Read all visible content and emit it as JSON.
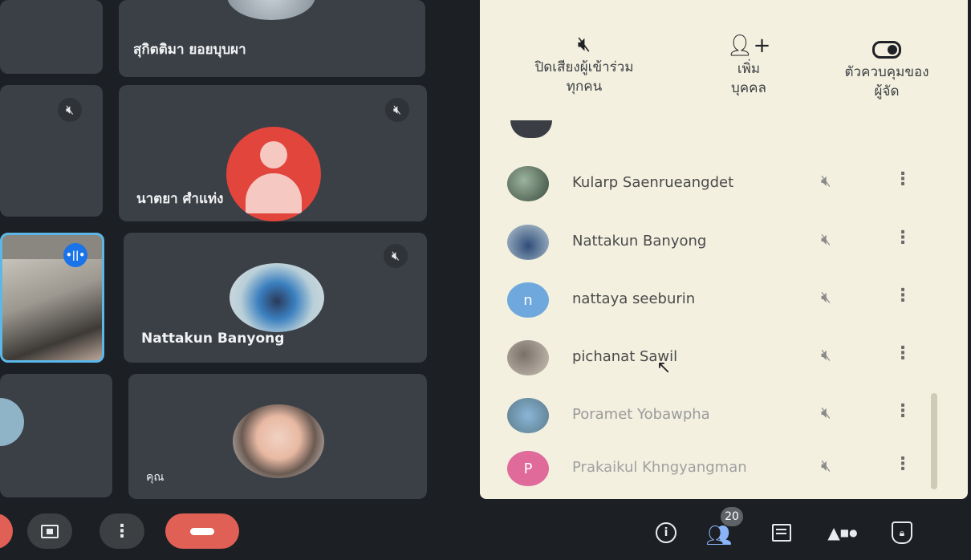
{
  "tiles": {
    "top_name": "สุกิตติมา ยอยบุบผา",
    "mid_name": "นาตยา ศำแท่ง",
    "nattakun_name": "Nattakun Banyong",
    "you_name": "คุณ"
  },
  "panel": {
    "actions": [
      {
        "icon": "mic-off-icon",
        "label_line1": "ปิดเสียงผู้เข้าร่วม",
        "label_line2": "ทุกคน"
      },
      {
        "icon": "add-person-icon",
        "label_line1": "เพิ่ม",
        "label_line2": "บุคคล"
      },
      {
        "icon": "toggle-icon",
        "label_line1": "ตัวควบคุมของ",
        "label_line2": "ผู้จัด"
      }
    ],
    "participants": [
      {
        "name": "Kularp Saenrueangdet"
      },
      {
        "name": "Nattakun Banyong"
      },
      {
        "name": "nattaya seeburin",
        "initial": "n"
      },
      {
        "name": "pichanat Sawil"
      },
      {
        "name": "Poramet Yobawpha"
      },
      {
        "name": "Prakaikul Khngyangman",
        "initial": "P"
      }
    ]
  },
  "bottom_bar": {
    "participants_count": "20"
  },
  "colors": {
    "end_call": "#e06055",
    "avatar_red": "#e2453c",
    "initial_blue": "#6fa8dc",
    "initial_pink": "#e06a9a",
    "speaking_blue": "#1a73e8"
  }
}
